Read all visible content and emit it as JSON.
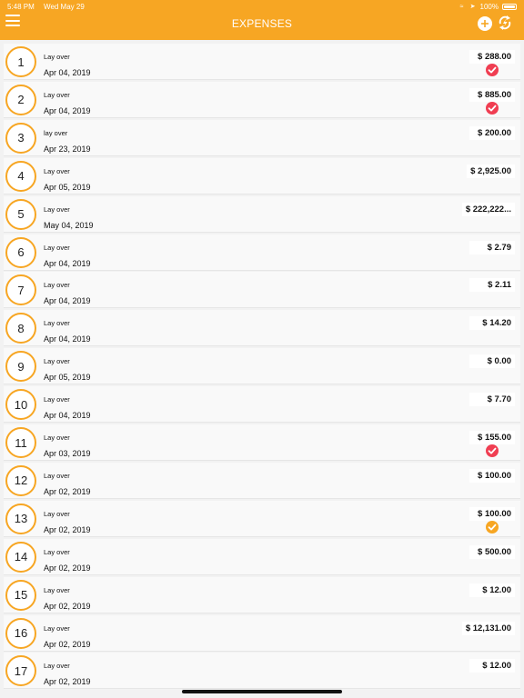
{
  "status_bar": {
    "time": "5:48 PM",
    "date": "Wed May 29",
    "battery": "100%"
  },
  "header": {
    "title": "EXPENSES"
  },
  "colors": {
    "accent": "#f7a623",
    "paid": "#f03e52",
    "pending": "#f7a623"
  },
  "expenses": [
    {
      "number": "1",
      "title": "Lay over",
      "date": "Apr 04, 2019",
      "amount": "$ 288.00",
      "status": "paid"
    },
    {
      "number": "2",
      "title": "Lay over",
      "date": "Apr 04, 2019",
      "amount": "$ 885.00",
      "status": "paid"
    },
    {
      "number": "3",
      "title": "lay over",
      "date": "Apr 23, 2019",
      "amount": "$ 200.00",
      "status": ""
    },
    {
      "number": "4",
      "title": "Lay over",
      "date": "Apr 05, 2019",
      "amount": "$ 2,925.00",
      "status": ""
    },
    {
      "number": "5",
      "title": "Lay over",
      "date": "May 04, 2019",
      "amount": "$ 222,222...",
      "status": ""
    },
    {
      "number": "6",
      "title": "Lay over",
      "date": "Apr 04, 2019",
      "amount": "$ 2.79",
      "status": ""
    },
    {
      "number": "7",
      "title": "Lay over",
      "date": "Apr 04, 2019",
      "amount": "$ 2.11",
      "status": ""
    },
    {
      "number": "8",
      "title": "Lay over",
      "date": "Apr 04, 2019",
      "amount": "$ 14.20",
      "status": ""
    },
    {
      "number": "9",
      "title": "Lay over",
      "date": "Apr 05, 2019",
      "amount": "$ 0.00",
      "status": ""
    },
    {
      "number": "10",
      "title": "Lay over",
      "date": "Apr 04, 2019",
      "amount": "$ 7.70",
      "status": ""
    },
    {
      "number": "11",
      "title": "Lay over",
      "date": "Apr 03, 2019",
      "amount": "$ 155.00",
      "status": "paid"
    },
    {
      "number": "12",
      "title": "Lay over",
      "date": "Apr 02, 2019",
      "amount": "$ 100.00",
      "status": ""
    },
    {
      "number": "13",
      "title": "Lay over",
      "date": "Apr 02, 2019",
      "amount": "$ 100.00",
      "status": "pending"
    },
    {
      "number": "14",
      "title": "Lay over",
      "date": "Apr 02, 2019",
      "amount": "$ 500.00",
      "status": ""
    },
    {
      "number": "15",
      "title": "Lay over",
      "date": "Apr 02, 2019",
      "amount": "$ 12.00",
      "status": ""
    },
    {
      "number": "16",
      "title": "Lay over",
      "date": "Apr 02, 2019",
      "amount": "$ 12,131.00",
      "status": ""
    },
    {
      "number": "17",
      "title": "Lay over",
      "date": "Apr 02, 2019",
      "amount": "$ 12.00",
      "status": ""
    }
  ]
}
